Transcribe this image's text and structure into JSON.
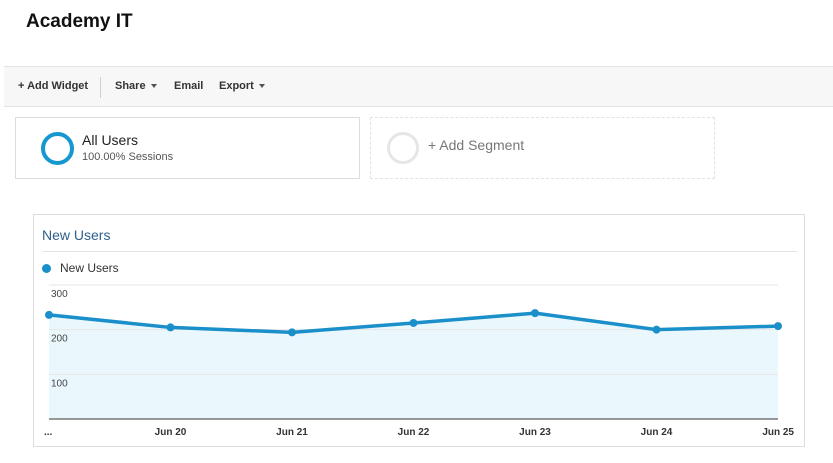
{
  "header": {
    "title": "Academy IT"
  },
  "toolbar": {
    "add_widget": "+ Add Widget",
    "share": "Share",
    "email": "Email",
    "export": "Export"
  },
  "segments": {
    "all_users": {
      "name": "All Users",
      "detail": "100.00% Sessions",
      "color": "#1598cf"
    },
    "add_segment": "+ Add Segment"
  },
  "widget": {
    "title": "New Users",
    "legend": "New Users",
    "series_color": "#1a8fc9",
    "fill_color": "#eaf8fd"
  },
  "chart_data": {
    "type": "area",
    "series": [
      {
        "name": "New Users",
        "values": [
          233,
          205,
          194,
          215,
          237,
          200,
          208
        ]
      }
    ],
    "x_labels": [
      "...",
      "Jun 20",
      "Jun 21",
      "Jun 22",
      "Jun 23",
      "Jun 24",
      "Jun 25"
    ],
    "y_ticks": [
      "100",
      "200",
      "300"
    ],
    "ylim": [
      0,
      300
    ],
    "grid": true,
    "legend_position": "top-left"
  }
}
